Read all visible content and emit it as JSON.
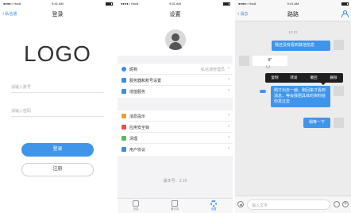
{
  "status": {
    "carrier": "●●●●○ Hooli",
    "time": "9:41 AM",
    "battery": "100%"
  },
  "login": {
    "back": "私信通",
    "title": "登录",
    "logo": "LOGO",
    "account_placeholder": "请输入账号",
    "password_placeholder": "请输入密码",
    "login_button": "登录",
    "register_button": "注册"
  },
  "settings": {
    "title": "设置",
    "group1": [
      {
        "icon": "person-icon",
        "color": "#3b8de5",
        "label": "昵称",
        "value": "私信通管理员"
      },
      {
        "icon": "server-icon",
        "color": "#3b8de5",
        "label": "服务器和账号设置",
        "value": ""
      },
      {
        "icon": "service-icon",
        "color": "#3b8de5",
        "label": "增值服务",
        "value": ""
      }
    ],
    "group2": [
      {
        "icon": "bell-icon",
        "color": "#f0a030",
        "label": "消息提示",
        "value": ""
      },
      {
        "icon": "lock-icon",
        "color": "#e9504a",
        "label": "应用安全锁",
        "value": ""
      },
      {
        "icon": "broom-icon",
        "color": "#5cb85c",
        "label": "清理",
        "value": ""
      },
      {
        "icon": "doc-icon",
        "color": "#3b8de5",
        "label": "用户协议",
        "value": ""
      }
    ],
    "version": "版本号：2.10",
    "tabs": [
      {
        "label": "消息",
        "icon": "chat-icon"
      },
      {
        "label": "通讯录",
        "icon": "contacts-icon"
      },
      {
        "label": "设置",
        "icon": "gear-icon"
      }
    ]
  },
  "chat": {
    "back": "消息",
    "title": "路路",
    "timestamp": "12:23",
    "messages": [
      {
        "from": "me",
        "text": "我还没有看到其他信息"
      },
      {
        "from": "other",
        "text": "8\""
      },
      {
        "from": "me",
        "text": "刚才出去一趟，刚回来才看到消息，等会我把具体的资料给你发过去"
      },
      {
        "from": "me",
        "text": "稍等一下"
      }
    ],
    "context_menu": [
      "复制",
      "转发",
      "撤回",
      "删除"
    ],
    "input_placeholder": "输入文字"
  }
}
